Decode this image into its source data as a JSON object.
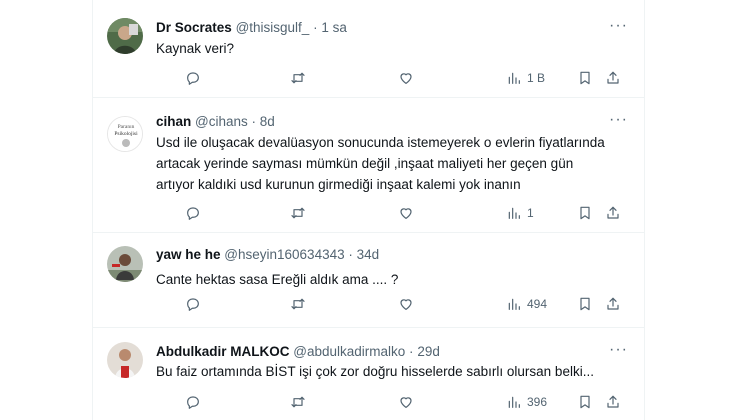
{
  "tweets": [
    {
      "name": "Dr Socrates",
      "handle": "@thisisgulf_",
      "dot": "·",
      "time": "1 sa",
      "lines": [
        "Kaynak veri?"
      ],
      "views": "1 B",
      "avatar_color": "#3f5a3a"
    },
    {
      "name": "cihan",
      "handle": "@cihans",
      "dot": "·",
      "time": "8d",
      "lines": [
        "Usd ile oluşacak devalüasyon sonucunda istemeyerek o evlerin fiyatlarında",
        "artacak yerinde sayması mümkün değil ,inşaat maliyeti her geçen gün",
        "artıyor kaldıki usd kurunun girmediği inşaat kalemi yok inanın"
      ],
      "views": "1",
      "avatar_color": "#ffffff",
      "avatar_text": [
        "Paranın",
        "Psikolojisi"
      ]
    },
    {
      "name": "yaw he he",
      "handle": "@hseyin160634343",
      "dot": "·",
      "time": "34d",
      "lines": [
        "Cante hektas sasa Ereğli aldık ama .... ?"
      ],
      "views": "494",
      "avatar_color": "#9aa39a"
    },
    {
      "name": "Abdulkadir MALKOC",
      "handle": "@abdulkadirmalko",
      "dot": "·",
      "time": "29d",
      "lines": [
        "Bu faiz ortamında BİST işi çok zor doğru hisselerde sabırlı olursan belki..."
      ],
      "views": "396",
      "avatar_color": "#d9d2cc"
    }
  ],
  "more_glyph": "···",
  "icons": {
    "reply": "reply-icon",
    "retweet": "retweet-icon",
    "like": "like-icon",
    "views": "views-icon",
    "bookmark": "bookmark-icon",
    "share": "share-icon",
    "more": "more-icon"
  },
  "colors": {
    "secondary_text": "#536471",
    "border": "#eff3f4",
    "primary_text": "#0f1419"
  }
}
